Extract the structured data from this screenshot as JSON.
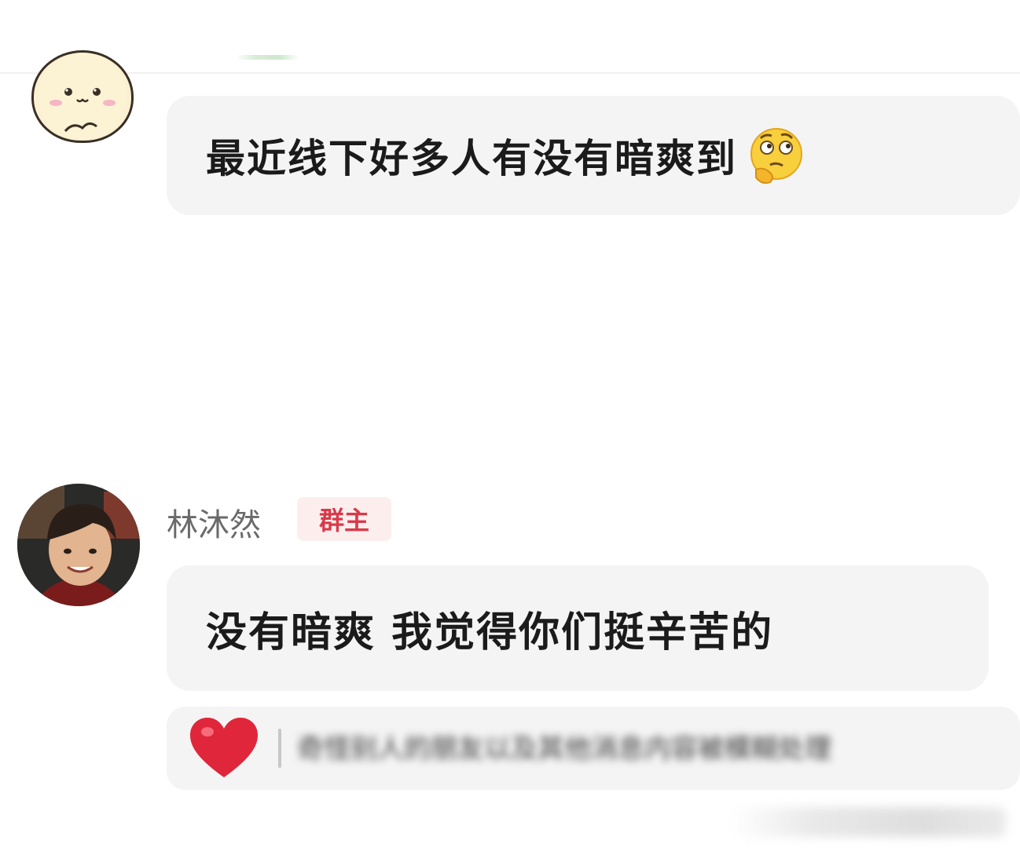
{
  "messages": [
    {
      "sender": "",
      "avatar_icon": "mascot-avatar-icon",
      "text": "最近线下好多人有没有暗爽到",
      "emoji_icon": "thinking-face-icon"
    },
    {
      "sender": "林沐然",
      "badge": "群主",
      "avatar_icon": "child-photo-avatar-icon",
      "text": "没有暗爽 我觉得你们挺辛苦的"
    }
  ],
  "reply_card": {
    "icon": "heart-icon",
    "preview": "奇怪别人的朋友以及其他消息内容被模糊处理"
  },
  "colors": {
    "bubble_bg": "#f4f4f4",
    "badge_text": "#d93a4a",
    "badge_bg": "#fdeeee",
    "heart": "#e0263a",
    "name_text": "#6a6a6a"
  }
}
